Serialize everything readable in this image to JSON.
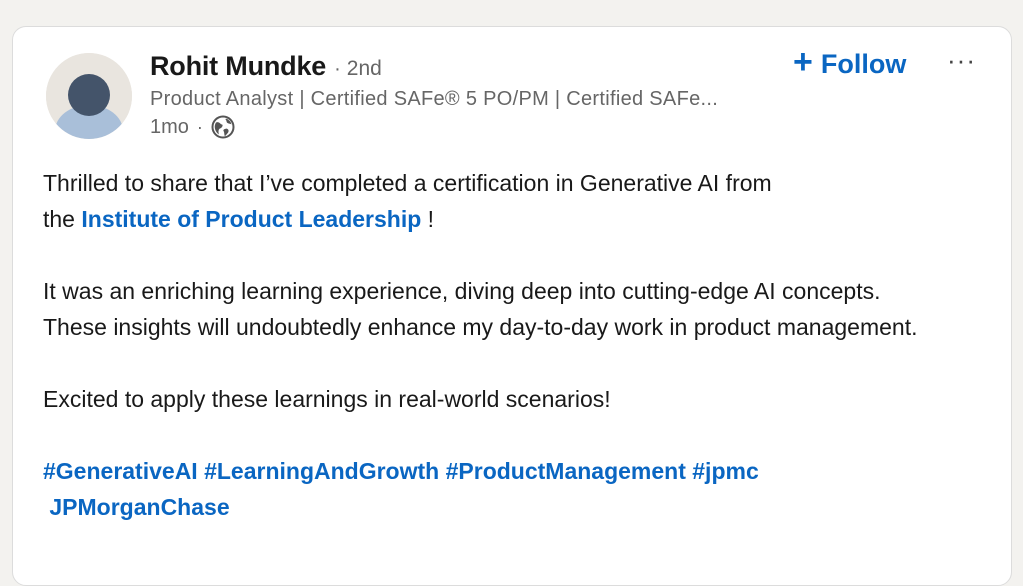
{
  "post": {
    "author": {
      "name": "Rohit Mundke",
      "connection_separator": "·",
      "degree": "2nd",
      "headline": "Product Analyst | Certified SAFe® 5 PO/PM | Certified SAFe...",
      "timestamp": "1mo",
      "meta_separator": "·",
      "visibility_icon": "globe-icon",
      "avatar_icon": "person-silhouette-icon"
    },
    "actions": {
      "follow_plus": "+",
      "follow_label": "Follow",
      "more_label": "···"
    },
    "body": {
      "line1_text": "Thrilled to share that I’ve completed a certification in Generative AI from",
      "line2_prefix": "the ",
      "mention": "Institute of Product Leadership",
      "line2_suffix": " !",
      "paragraph2": "It was an enriching learning experience, diving deep into cutting-edge AI concepts. These insights will undoubtedly enhance my day-to-day work in product management.",
      "paragraph3": "Excited to apply these learnings in real-world scenarios!",
      "hashtags": [
        "#GenerativeAI",
        "#LearningAndGrowth",
        "#ProductManagement",
        "#jpmc"
      ],
      "company_mention": "JPMorganChase"
    }
  },
  "colors": {
    "link_blue": "#0a66c2",
    "text_primary": "#191919",
    "text_secondary": "#666666",
    "card_background": "#ffffff",
    "page_background": "#f3f2ef"
  }
}
